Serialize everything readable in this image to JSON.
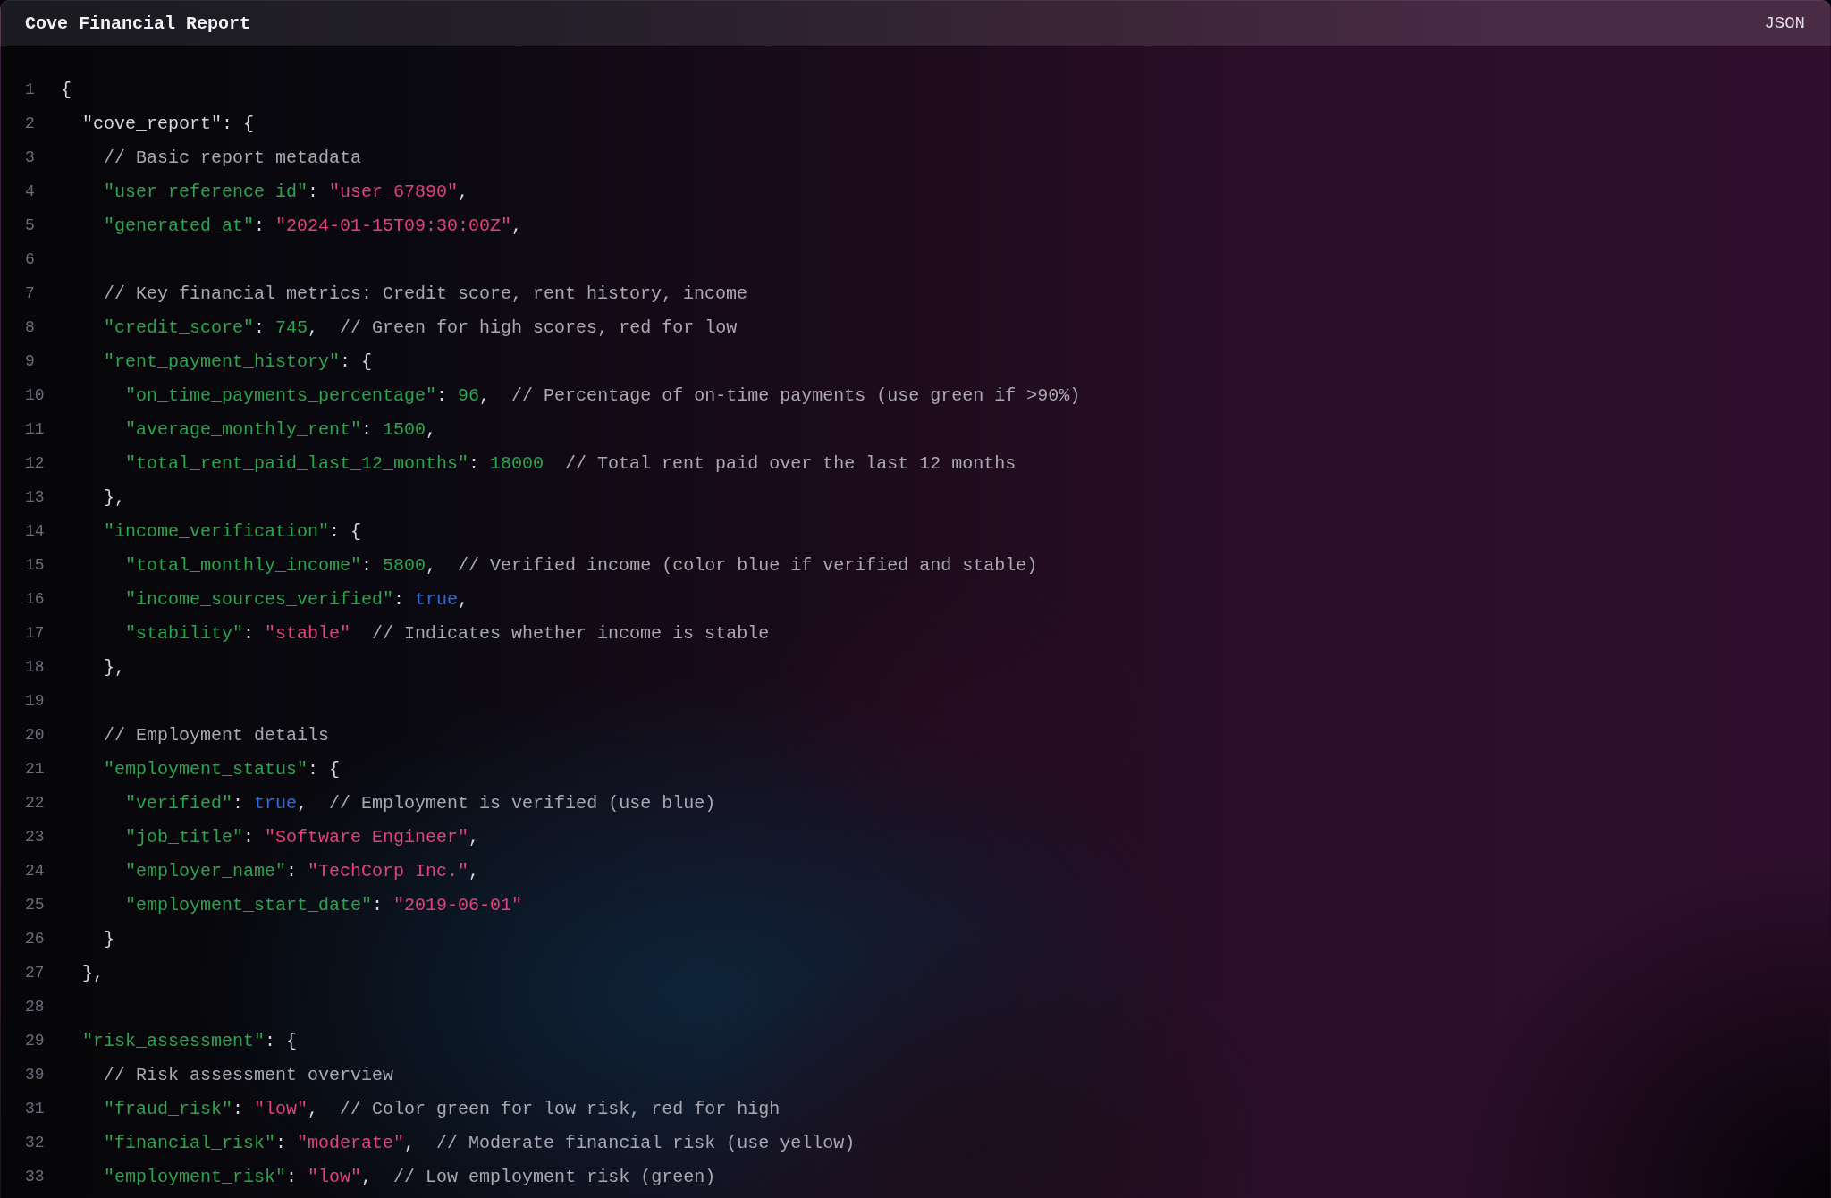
{
  "window": {
    "title": "Cove Financial Report",
    "language": "JSON"
  },
  "editor": {
    "lines": [
      {
        "number": "1",
        "tokens": [
          {
            "kind": "plain",
            "text": "{"
          }
        ],
        "children": [
          {
            "number": "2",
            "tokens": [
              {
                "kind": "plain",
                "text": "\"cove_report\": {"
              }
            ],
            "children": [
              {
                "number": "3",
                "comment": "// Basic report metadata"
              },
              {
                "number": "4",
                "tokens": [
                  {
                    "kind": "key",
                    "text": "\"user_reference_id\""
                  },
                  {
                    "kind": "plain",
                    "text": ": "
                  },
                  {
                    "kind": "string",
                    "text": "\"user_67890\""
                  },
                  {
                    "kind": "plain",
                    "text": ","
                  }
                ]
              },
              {
                "number": "5",
                "tokens": [
                  {
                    "kind": "key",
                    "text": "\"generated_at\""
                  },
                  {
                    "kind": "plain",
                    "text": ": "
                  },
                  {
                    "kind": "string",
                    "text": "\"2024-01-15T09:30:00Z\""
                  },
                  {
                    "kind": "plain",
                    "text": ","
                  }
                ]
              },
              {
                "number": "6"
              },
              {
                "number": "7",
                "comment": "// Key financial metrics: Credit score, rent history, income"
              },
              {
                "number": "8",
                "tokens": [
                  {
                    "kind": "key",
                    "text": "\"credit_score\""
                  },
                  {
                    "kind": "plain",
                    "text": ": "
                  },
                  {
                    "kind": "number",
                    "text": "745"
                  },
                  {
                    "kind": "plain",
                    "text": ","
                  }
                ],
                "comment": "// Green for high scores, red for low"
              },
              {
                "number": "9",
                "tokens": [
                  {
                    "kind": "key",
                    "text": "\"rent_payment_history\""
                  },
                  {
                    "kind": "plain",
                    "text": ": {"
                  }
                ],
                "children": [
                  {
                    "number": "10",
                    "tokens": [
                      {
                        "kind": "key",
                        "text": "\"on_time_payments_percentage\""
                      },
                      {
                        "kind": "plain",
                        "text": ": "
                      },
                      {
                        "kind": "number",
                        "text": "96"
                      },
                      {
                        "kind": "plain",
                        "text": ","
                      }
                    ],
                    "comment": "// Percentage of on-time payments (use green if >90%)"
                  },
                  {
                    "number": "11",
                    "tokens": [
                      {
                        "kind": "key",
                        "text": "\"average_monthly_rent\""
                      },
                      {
                        "kind": "plain",
                        "text": ": "
                      },
                      {
                        "kind": "number",
                        "text": "1500"
                      },
                      {
                        "kind": "plain",
                        "text": ","
                      }
                    ]
                  },
                  {
                    "number": "12",
                    "tokens": [
                      {
                        "kind": "key",
                        "text": "\"total_rent_paid_last_12_months\""
                      },
                      {
                        "kind": "plain",
                        "text": ": "
                      },
                      {
                        "kind": "number",
                        "text": "18000"
                      }
                    ],
                    "comment": "// Total rent paid over the last 12 months"
                  }
                ]
              },
              {
                "number": "13",
                "tokens": [
                  {
                    "kind": "plain",
                    "text": "},"
                  }
                ]
              },
              {
                "number": "14",
                "tokens": [
                  {
                    "kind": "key",
                    "text": "\"income_verification\""
                  },
                  {
                    "kind": "plain",
                    "text": ": {"
                  }
                ],
                "children": [
                  {
                    "number": "15",
                    "tokens": [
                      {
                        "kind": "key",
                        "text": "\"total_monthly_income\""
                      },
                      {
                        "kind": "plain",
                        "text": ": "
                      },
                      {
                        "kind": "number",
                        "text": "5800"
                      },
                      {
                        "kind": "plain",
                        "text": ","
                      }
                    ],
                    "comment": "// Verified income (color blue if verified and stable)"
                  },
                  {
                    "number": "16",
                    "tokens": [
                      {
                        "kind": "key",
                        "text": "\"income_sources_verified\""
                      },
                      {
                        "kind": "plain",
                        "text": ": "
                      },
                      {
                        "kind": "boolean",
                        "text": "true"
                      },
                      {
                        "kind": "plain",
                        "text": ","
                      }
                    ]
                  },
                  {
                    "number": "17",
                    "tokens": [
                      {
                        "kind": "key",
                        "text": "\"stability\""
                      },
                      {
                        "kind": "plain",
                        "text": ": "
                      },
                      {
                        "kind": "string",
                        "text": "\"stable\""
                      }
                    ],
                    "comment": "// Indicates whether income is stable"
                  }
                ]
              },
              {
                "number": "18",
                "tokens": [
                  {
                    "kind": "plain",
                    "text": "},"
                  }
                ]
              },
              {
                "number": "19"
              },
              {
                "number": "20",
                "comment": "// Employment details"
              },
              {
                "number": "21",
                "tokens": [
                  {
                    "kind": "key",
                    "text": "\"employment_status\""
                  },
                  {
                    "kind": "plain",
                    "text": ": {"
                  }
                ],
                "children": [
                  {
                    "number": "22",
                    "tokens": [
                      {
                        "kind": "key",
                        "text": "\"verified\""
                      },
                      {
                        "kind": "plain",
                        "text": ": "
                      },
                      {
                        "kind": "boolean",
                        "text": "true"
                      },
                      {
                        "kind": "plain",
                        "text": ","
                      }
                    ],
                    "comment": "// Employment is verified (use blue)"
                  },
                  {
                    "number": "23",
                    "tokens": [
                      {
                        "kind": "key",
                        "text": "\"job_title\""
                      },
                      {
                        "kind": "plain",
                        "text": ": "
                      },
                      {
                        "kind": "string",
                        "text": "\"Software Engineer\""
                      },
                      {
                        "kind": "plain",
                        "text": ","
                      }
                    ]
                  },
                  {
                    "number": "24",
                    "tokens": [
                      {
                        "kind": "key",
                        "text": "\"employer_name\""
                      },
                      {
                        "kind": "plain",
                        "text": ": "
                      },
                      {
                        "kind": "string",
                        "text": "\"TechCorp Inc.\""
                      },
                      {
                        "kind": "plain",
                        "text": ","
                      }
                    ]
                  },
                  {
                    "number": "25",
                    "tokens": [
                      {
                        "kind": "key",
                        "text": "\"employment_start_date\""
                      },
                      {
                        "kind": "plain",
                        "text": ": "
                      },
                      {
                        "kind": "string",
                        "text": "\"2019-06-01\""
                      }
                    ]
                  }
                ]
              },
              {
                "number": "26",
                "tokens": [
                  {
                    "kind": "plain",
                    "text": "}"
                  }
                ]
              }
            ]
          },
          {
            "number": "27",
            "tokens": [
              {
                "kind": "plain",
                "text": "},"
              }
            ]
          },
          {
            "number": "28"
          },
          {
            "number": "29",
            "tokens": [
              {
                "kind": "key",
                "text": "\"risk_assessment\""
              },
              {
                "kind": "plain",
                "text": ": {"
              }
            ],
            "children": [
              {
                "number": "39",
                "comment": "// Risk assessment overview"
              },
              {
                "number": "31",
                "tokens": [
                  {
                    "kind": "key",
                    "text": "\"fraud_risk\""
                  },
                  {
                    "kind": "plain",
                    "text": ": "
                  },
                  {
                    "kind": "string",
                    "text": "\"low\""
                  },
                  {
                    "kind": "plain",
                    "text": ","
                  }
                ],
                "comment": "// Color green for low risk, red for high"
              },
              {
                "number": "32",
                "tokens": [
                  {
                    "kind": "key",
                    "text": "\"financial_risk\""
                  },
                  {
                    "kind": "plain",
                    "text": ": "
                  },
                  {
                    "kind": "string",
                    "text": "\"moderate\""
                  },
                  {
                    "kind": "plain",
                    "text": ","
                  }
                ],
                "comment": "// Moderate financial risk (use yellow)"
              },
              {
                "number": "33",
                "tokens": [
                  {
                    "kind": "key",
                    "text": "\"employment_risk\""
                  },
                  {
                    "kind": "plain",
                    "text": ": "
                  },
                  {
                    "kind": "string",
                    "text": "\"low\""
                  },
                  {
                    "kind": "plain",
                    "text": ","
                  }
                ],
                "comment": "// Low employment risk (green)"
              }
            ]
          }
        ]
      }
    ]
  }
}
